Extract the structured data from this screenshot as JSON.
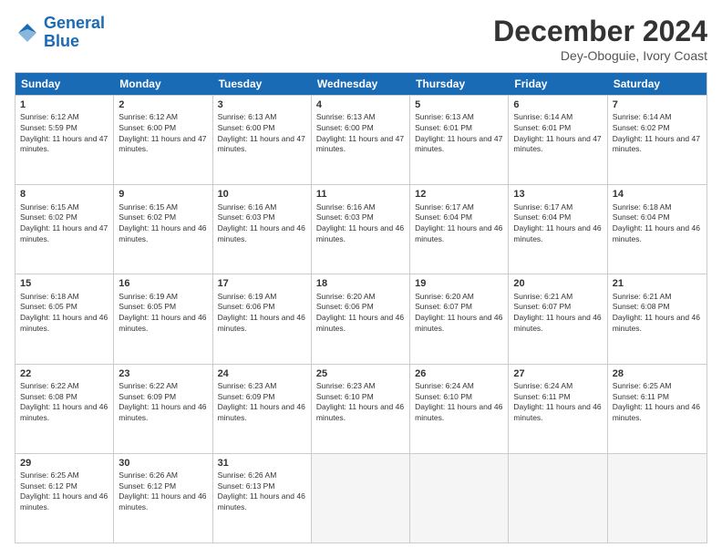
{
  "logo": {
    "line1": "General",
    "line2": "Blue"
  },
  "title": "December 2024",
  "subtitle": "Dey-Oboguie, Ivory Coast",
  "days": [
    "Sunday",
    "Monday",
    "Tuesday",
    "Wednesday",
    "Thursday",
    "Friday",
    "Saturday"
  ],
  "weeks": [
    [
      {
        "day": 1,
        "rise": "6:12 AM",
        "set": "5:59 PM",
        "dl": "11 hours and 47 minutes."
      },
      {
        "day": 2,
        "rise": "6:12 AM",
        "set": "6:00 PM",
        "dl": "11 hours and 47 minutes."
      },
      {
        "day": 3,
        "rise": "6:13 AM",
        "set": "6:00 PM",
        "dl": "11 hours and 47 minutes."
      },
      {
        "day": 4,
        "rise": "6:13 AM",
        "set": "6:00 PM",
        "dl": "11 hours and 47 minutes."
      },
      {
        "day": 5,
        "rise": "6:13 AM",
        "set": "6:01 PM",
        "dl": "11 hours and 47 minutes."
      },
      {
        "day": 6,
        "rise": "6:14 AM",
        "set": "6:01 PM",
        "dl": "11 hours and 47 minutes."
      },
      {
        "day": 7,
        "rise": "6:14 AM",
        "set": "6:02 PM",
        "dl": "11 hours and 47 minutes."
      }
    ],
    [
      {
        "day": 8,
        "rise": "6:15 AM",
        "set": "6:02 PM",
        "dl": "11 hours and 47 minutes."
      },
      {
        "day": 9,
        "rise": "6:15 AM",
        "set": "6:02 PM",
        "dl": "11 hours and 46 minutes."
      },
      {
        "day": 10,
        "rise": "6:16 AM",
        "set": "6:03 PM",
        "dl": "11 hours and 46 minutes."
      },
      {
        "day": 11,
        "rise": "6:16 AM",
        "set": "6:03 PM",
        "dl": "11 hours and 46 minutes."
      },
      {
        "day": 12,
        "rise": "6:17 AM",
        "set": "6:04 PM",
        "dl": "11 hours and 46 minutes."
      },
      {
        "day": 13,
        "rise": "6:17 AM",
        "set": "6:04 PM",
        "dl": "11 hours and 46 minutes."
      },
      {
        "day": 14,
        "rise": "6:18 AM",
        "set": "6:04 PM",
        "dl": "11 hours and 46 minutes."
      }
    ],
    [
      {
        "day": 15,
        "rise": "6:18 AM",
        "set": "6:05 PM",
        "dl": "11 hours and 46 minutes."
      },
      {
        "day": 16,
        "rise": "6:19 AM",
        "set": "6:05 PM",
        "dl": "11 hours and 46 minutes."
      },
      {
        "day": 17,
        "rise": "6:19 AM",
        "set": "6:06 PM",
        "dl": "11 hours and 46 minutes."
      },
      {
        "day": 18,
        "rise": "6:20 AM",
        "set": "6:06 PM",
        "dl": "11 hours and 46 minutes."
      },
      {
        "day": 19,
        "rise": "6:20 AM",
        "set": "6:07 PM",
        "dl": "11 hours and 46 minutes."
      },
      {
        "day": 20,
        "rise": "6:21 AM",
        "set": "6:07 PM",
        "dl": "11 hours and 46 minutes."
      },
      {
        "day": 21,
        "rise": "6:21 AM",
        "set": "6:08 PM",
        "dl": "11 hours and 46 minutes."
      }
    ],
    [
      {
        "day": 22,
        "rise": "6:22 AM",
        "set": "6:08 PM",
        "dl": "11 hours and 46 minutes."
      },
      {
        "day": 23,
        "rise": "6:22 AM",
        "set": "6:09 PM",
        "dl": "11 hours and 46 minutes."
      },
      {
        "day": 24,
        "rise": "6:23 AM",
        "set": "6:09 PM",
        "dl": "11 hours and 46 minutes."
      },
      {
        "day": 25,
        "rise": "6:23 AM",
        "set": "6:10 PM",
        "dl": "11 hours and 46 minutes."
      },
      {
        "day": 26,
        "rise": "6:24 AM",
        "set": "6:10 PM",
        "dl": "11 hours and 46 minutes."
      },
      {
        "day": 27,
        "rise": "6:24 AM",
        "set": "6:11 PM",
        "dl": "11 hours and 46 minutes."
      },
      {
        "day": 28,
        "rise": "6:25 AM",
        "set": "6:11 PM",
        "dl": "11 hours and 46 minutes."
      }
    ],
    [
      {
        "day": 29,
        "rise": "6:25 AM",
        "set": "6:12 PM",
        "dl": "11 hours and 46 minutes."
      },
      {
        "day": 30,
        "rise": "6:26 AM",
        "set": "6:12 PM",
        "dl": "11 hours and 46 minutes."
      },
      {
        "day": 31,
        "rise": "6:26 AM",
        "set": "6:13 PM",
        "dl": "11 hours and 46 minutes."
      },
      null,
      null,
      null,
      null
    ]
  ]
}
